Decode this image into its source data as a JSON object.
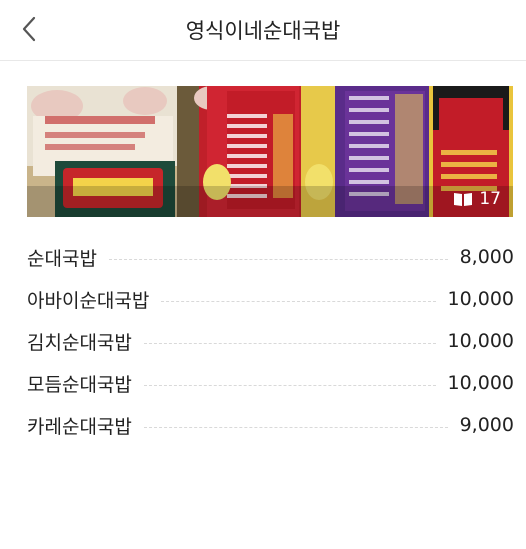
{
  "header": {
    "title": "영식이네순대국밥"
  },
  "photo": {
    "count": "17"
  },
  "menu": [
    {
      "name": "순대국밥",
      "price": "8,000"
    },
    {
      "name": "아바이순대국밥",
      "price": "10,000"
    },
    {
      "name": "김치순대국밥",
      "price": "10,000"
    },
    {
      "name": "모듬순대국밥",
      "price": "10,000"
    },
    {
      "name": "카레순대국밥",
      "price": "9,000"
    }
  ]
}
